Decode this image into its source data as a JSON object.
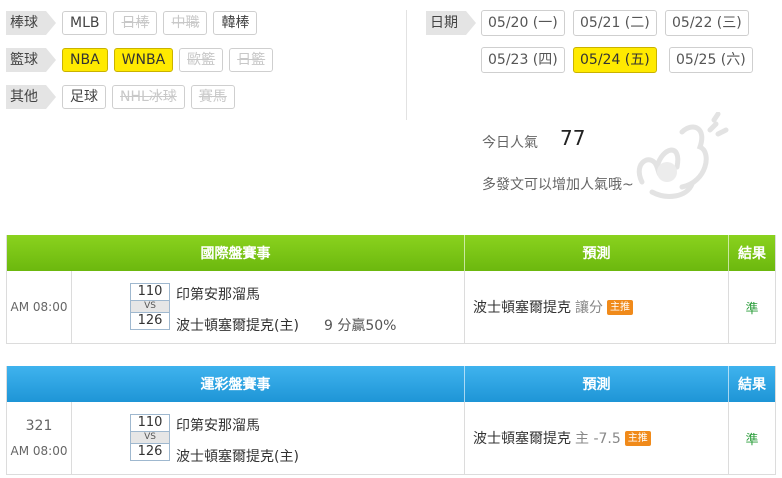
{
  "sports": [
    {
      "label": "棒球",
      "items": [
        {
          "label": "MLB",
          "state": "normal"
        },
        {
          "label": "日棒",
          "state": "off"
        },
        {
          "label": "中職",
          "state": "off"
        },
        {
          "label": "韓棒",
          "state": "normal"
        }
      ]
    },
    {
      "label": "籃球",
      "items": [
        {
          "label": "NBA",
          "state": "on"
        },
        {
          "label": "WNBA",
          "state": "on"
        },
        {
          "label": "歐籃",
          "state": "off"
        },
        {
          "label": "日籃",
          "state": "off"
        }
      ]
    },
    {
      "label": "其他",
      "items": [
        {
          "label": "足球",
          "state": "normal"
        },
        {
          "label": "NHL冰球",
          "state": "off"
        },
        {
          "label": "賽馬",
          "state": "off"
        }
      ]
    }
  ],
  "dates": {
    "label": "日期",
    "items": [
      {
        "label": "05/20 (一)",
        "selected": false
      },
      {
        "label": "05/21 (二)",
        "selected": false
      },
      {
        "label": "05/22 (三)",
        "selected": false
      },
      {
        "label": "05/23 (四)",
        "selected": false
      },
      {
        "label": "05/24 (五)",
        "selected": true
      },
      {
        "label": "05/25 (六)",
        "selected": false
      }
    ]
  },
  "popularity": {
    "label": "今日人氣",
    "value": "77",
    "tip": "多發文可以增加人氣哦~"
  },
  "international": {
    "headers": {
      "game": "國際盤賽事",
      "prediction": "預測",
      "result": "結果"
    },
    "game": {
      "number": "",
      "time": "AM 08:00",
      "away_score": "110",
      "vs": "VS",
      "home_score": "126",
      "away_team": "印第安那溜馬",
      "home_team": "波士頓塞爾提克(主)",
      "note": "9 分贏50%",
      "prediction_team": "波士頓塞爾提克",
      "prediction_detail": "讓分",
      "badge": "主推",
      "result": "準"
    }
  },
  "lottery": {
    "headers": {
      "game": "運彩盤賽事",
      "prediction": "預測",
      "result": "結果"
    },
    "game": {
      "number": "321",
      "time": "AM 08:00",
      "away_score": "110",
      "vs": "VS",
      "home_score": "126",
      "away_team": "印第安那溜馬",
      "home_team": "波士頓塞爾提克(主)",
      "prediction_team": "波士頓塞爾提克",
      "prediction_detail": "主 -7.5",
      "badge": "主推",
      "result": "準"
    }
  },
  "colors": {
    "selected": "#ffea00",
    "green_header": "#7cc515",
    "blue_header": "#2aa3e2",
    "badge": "#f08a1a"
  }
}
